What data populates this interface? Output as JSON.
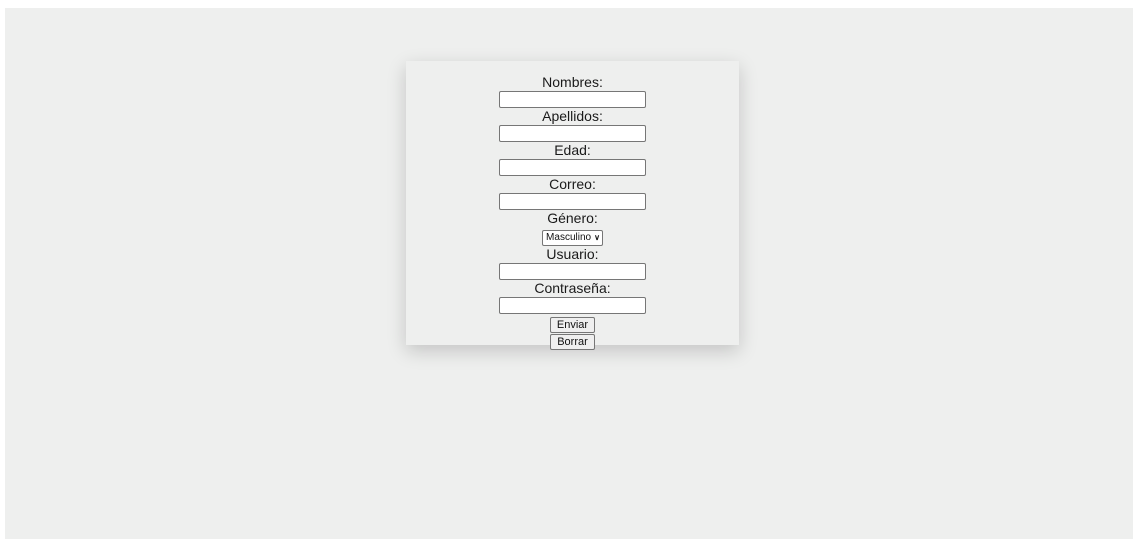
{
  "form": {
    "nombres_label": "Nombres:",
    "nombres_value": "",
    "apellidos_label": "Apellidos:",
    "apellidos_value": "",
    "edad_label": "Edad:",
    "edad_value": "",
    "correo_label": "Correo:",
    "correo_value": "",
    "genero_label": "Género:",
    "genero_selected": "Masculino",
    "usuario_label": "Usuario:",
    "usuario_value": "",
    "contrasena_label": "Contraseña:",
    "contrasena_value": "",
    "enviar_label": "Enviar",
    "borrar_label": "Borrar"
  },
  "icons": {
    "select_chevron": "chevron-down-icon"
  },
  "colors": {
    "page_background": "#eeefee",
    "card_background": "#eeefee",
    "input_border": "#767676",
    "button_background": "#efefef"
  }
}
